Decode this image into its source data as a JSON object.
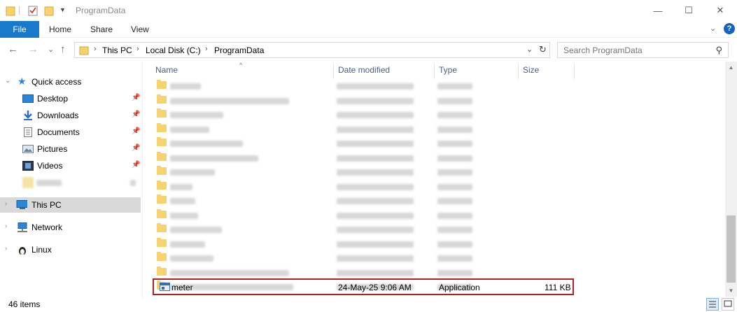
{
  "window": {
    "title": "ProgramData",
    "minimize_glyph": "—",
    "maximize_glyph": "☐",
    "close_glyph": "✕"
  },
  "ribbon": {
    "file_label": "File",
    "tabs": [
      "Home",
      "Share",
      "View"
    ],
    "expand_glyph": "⌄",
    "help_glyph": "?"
  },
  "address": {
    "back_glyph": "←",
    "forward_glyph": "→",
    "recent_glyph": "⌄",
    "up_glyph": "↑",
    "crumbs": [
      "This PC",
      "Local Disk (C:)",
      "ProgramData"
    ],
    "sep_glyph": "›",
    "drop_glyph": "⌄",
    "refresh_glyph": "↻"
  },
  "search": {
    "placeholder": "Search ProgramData",
    "icon_glyph": "⚲"
  },
  "nav": {
    "chevron_glyph": "›",
    "expanded_glyph": "⌄",
    "pin_glyph": "📌",
    "quick_access": "Quick access",
    "quick_items": [
      "Desktop",
      "Downloads",
      "Documents",
      "Pictures",
      "Videos"
    ],
    "this_pc": "This PC",
    "network": "Network",
    "linux": "Linux"
  },
  "columns": {
    "name": "Name",
    "date": "Date modified",
    "type": "Type",
    "size": "Size",
    "sort_glyph": "^"
  },
  "highlighted_file": {
    "name": "meter",
    "date": "24-May-25 9:06 AM",
    "type": "Application",
    "size": "111 KB"
  },
  "status": {
    "item_count": "46 items"
  },
  "colors": {
    "accent": "#1979ca",
    "highlight_border": "#b22222",
    "folder": "#f6d36e",
    "header_text": "#4d6082"
  }
}
